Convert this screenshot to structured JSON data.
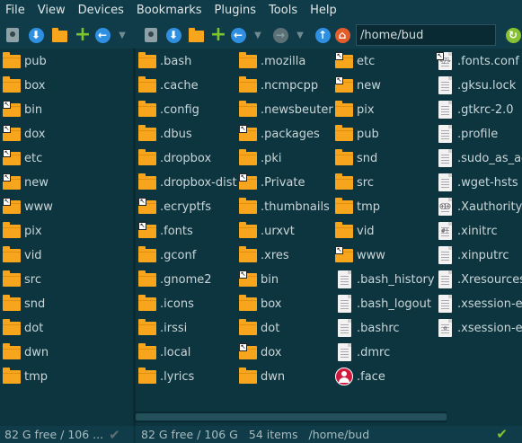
{
  "menubar": {
    "items": [
      "File",
      "View",
      "Devices",
      "Bookmarks",
      "Plugins",
      "Tools",
      "Help"
    ]
  },
  "toolbar": {
    "path": "/home/bud"
  },
  "left_pane": {
    "items": [
      {
        "name": "pub",
        "type": "folder",
        "link": false
      },
      {
        "name": "box",
        "type": "folder",
        "link": false
      },
      {
        "name": "bin",
        "type": "folder",
        "link": true
      },
      {
        "name": "dox",
        "type": "folder",
        "link": true
      },
      {
        "name": "etc",
        "type": "folder",
        "link": true
      },
      {
        "name": "new",
        "type": "folder",
        "link": true
      },
      {
        "name": "www",
        "type": "folder",
        "link": true
      },
      {
        "name": "pix",
        "type": "folder",
        "link": false
      },
      {
        "name": "vid",
        "type": "folder",
        "link": false
      },
      {
        "name": "src",
        "type": "folder",
        "link": false
      },
      {
        "name": "snd",
        "type": "folder",
        "link": false
      },
      {
        "name": "dot",
        "type": "folder",
        "link": false
      },
      {
        "name": "dwn",
        "type": "folder",
        "link": false
      },
      {
        "name": "tmp",
        "type": "folder",
        "link": false
      }
    ],
    "status": "82 G free / 106 ..."
  },
  "right_pane": {
    "columns": [
      [
        {
          "name": ".bash",
          "type": "folder",
          "link": false
        },
        {
          "name": ".cache",
          "type": "folder",
          "link": false
        },
        {
          "name": ".config",
          "type": "folder",
          "link": false
        },
        {
          "name": ".dbus",
          "type": "folder",
          "link": false
        },
        {
          "name": ".dropbox",
          "type": "folder",
          "link": false
        },
        {
          "name": ".dropbox-dist",
          "type": "folder",
          "link": false
        },
        {
          "name": ".ecryptfs",
          "type": "folder",
          "link": true
        },
        {
          "name": ".fonts",
          "type": "folder",
          "link": true
        },
        {
          "name": ".gconf",
          "type": "folder",
          "link": false
        },
        {
          "name": ".gnome2",
          "type": "folder",
          "link": false
        },
        {
          "name": ".icons",
          "type": "folder",
          "link": false
        },
        {
          "name": ".irssi",
          "type": "folder",
          "link": false
        },
        {
          "name": ".local",
          "type": "folder",
          "link": false
        },
        {
          "name": ".lyrics",
          "type": "folder",
          "link": false
        }
      ],
      [
        {
          "name": ".mozilla",
          "type": "folder",
          "link": false
        },
        {
          "name": ".ncmpcpp",
          "type": "folder",
          "link": false
        },
        {
          "name": ".newsbeuter",
          "type": "folder",
          "link": false
        },
        {
          "name": ".packages",
          "type": "folder",
          "link": true
        },
        {
          "name": ".pki",
          "type": "folder",
          "link": false
        },
        {
          "name": ".Private",
          "type": "folder",
          "link": true
        },
        {
          "name": ".thumbnails",
          "type": "folder",
          "link": false
        },
        {
          "name": ".urxvt",
          "type": "folder",
          "link": false
        },
        {
          "name": ".xres",
          "type": "folder",
          "link": false
        },
        {
          "name": "bin",
          "type": "folder",
          "link": true
        },
        {
          "name": "box",
          "type": "folder",
          "link": false
        },
        {
          "name": "dot",
          "type": "folder",
          "link": false
        },
        {
          "name": "dox",
          "type": "folder",
          "link": true
        },
        {
          "name": "dwn",
          "type": "folder",
          "link": false
        }
      ],
      [
        {
          "name": "etc",
          "type": "folder",
          "link": true
        },
        {
          "name": "new",
          "type": "folder",
          "link": true
        },
        {
          "name": "pix",
          "type": "folder",
          "link": false
        },
        {
          "name": "pub",
          "type": "folder",
          "link": false
        },
        {
          "name": "snd",
          "type": "folder",
          "link": false
        },
        {
          "name": "src",
          "type": "folder",
          "link": false
        },
        {
          "name": "tmp",
          "type": "folder",
          "link": false
        },
        {
          "name": "vid",
          "type": "folder",
          "link": false
        },
        {
          "name": "www",
          "type": "folder",
          "link": true
        },
        {
          "name": ".bash_history",
          "type": "doc",
          "link": false
        },
        {
          "name": ".bash_logout",
          "type": "doc",
          "link": false
        },
        {
          "name": ".bashrc",
          "type": "doc",
          "link": false
        },
        {
          "name": ".dmrc",
          "type": "doc",
          "link": false
        },
        {
          "name": ".face",
          "type": "face",
          "link": false
        }
      ],
      [
        {
          "name": ".fonts.conf",
          "type": "code",
          "link": true
        },
        {
          "name": ".gksu.lock",
          "type": "doc",
          "link": false
        },
        {
          "name": ".gtkrc-2.0",
          "type": "doc",
          "link": false
        },
        {
          "name": ".profile",
          "type": "doc",
          "link": false
        },
        {
          "name": ".sudo_as_ad",
          "type": "doc",
          "link": false
        },
        {
          "name": ".wget-hsts",
          "type": "doc",
          "link": false
        },
        {
          "name": ".Xauthority",
          "type": "exec",
          "link": false
        },
        {
          "name": ".xinitrc",
          "type": "exec2",
          "link": false
        },
        {
          "name": ".xinputrc",
          "type": "doc",
          "link": false
        },
        {
          "name": ".Xresources",
          "type": "doc",
          "link": false
        },
        {
          "name": ".xsession-er",
          "type": "doc",
          "link": false
        },
        {
          "name": ".xsession-er",
          "type": "recycle",
          "link": false
        }
      ]
    ],
    "status": {
      "free": "82 G free / 106 G",
      "count": "54 items",
      "path": "/home/bud"
    }
  }
}
